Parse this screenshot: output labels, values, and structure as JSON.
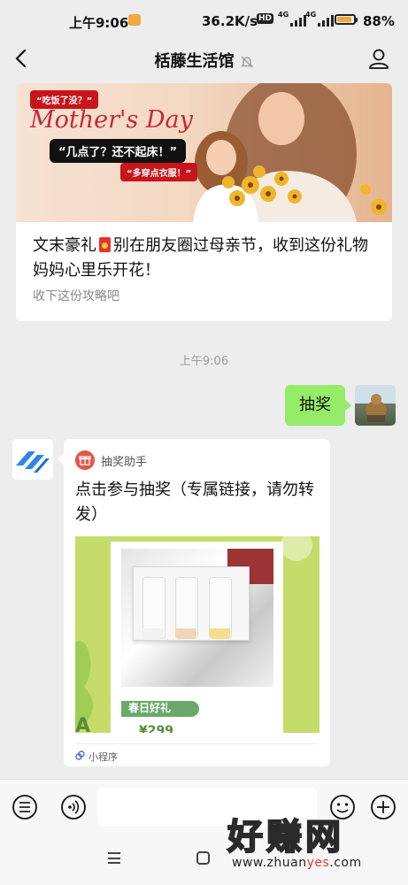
{
  "status_bar": {
    "time": "上午9:06",
    "network_speed": "36.2K/s",
    "hd_badge": "HD",
    "signal1_type": "4G",
    "signal2_type": "4G",
    "battery_percent": "88%",
    "battery_level": 0.88,
    "battery_color": "#f2a93b"
  },
  "title_bar": {
    "title": "栝藤生活馆",
    "back_icon": "chevron-left-icon",
    "mute_icon": "bell-off-icon",
    "profile_icon": "person-icon"
  },
  "article": {
    "banner": {
      "bubble_1": "“吃饭了没？”",
      "heading": "Mother's Day",
      "bubble_2": "“几点了？还不起床！”",
      "bubble_3": "“多穿点衣服！”"
    },
    "title_prefix": "文末豪礼",
    "title_rest": "别在朋友圈过母亲节，收到这份礼物妈妈心里乐开花！",
    "subtitle": "收下这份攻略吧"
  },
  "timestamp": "上午9:06",
  "sent_message": {
    "text": "抽奖",
    "bubble_color": "#95ec69"
  },
  "mini_program_card": {
    "app_name": "抽奖助手",
    "title": "点击参与抽奖（专属链接，请勿转发）",
    "image": {
      "band_text": "春日好礼",
      "corner_letter": "A",
      "price_fragment": "¥299"
    },
    "footer_label": "小程序"
  },
  "input_bar": {
    "menu_icon": "menu-icon",
    "voice_icon": "voice-icon",
    "emoji_icon": "emoji-icon",
    "add_icon": "plus-icon"
  },
  "watermark": {
    "big_text": "好赚网",
    "url_prefix": "www.zhuan",
    "url_highlight": "yes",
    "url_suffix": ".com"
  }
}
